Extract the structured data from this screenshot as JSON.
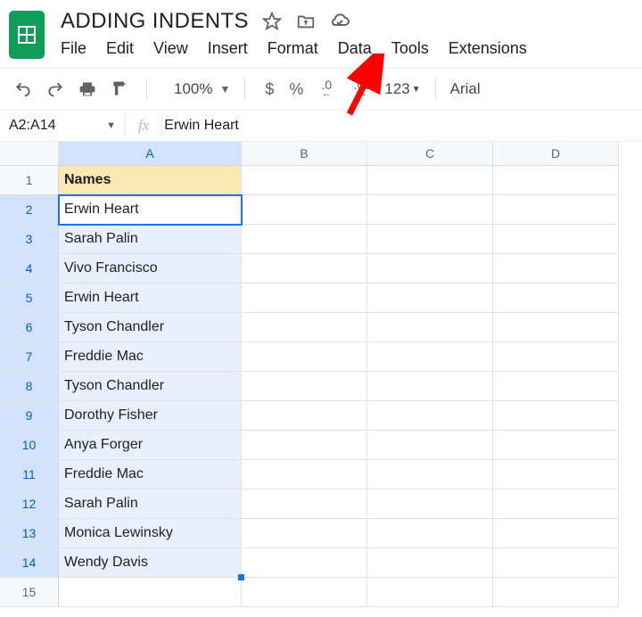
{
  "doc": {
    "title": "ADDING INDENTS"
  },
  "menubar": [
    "File",
    "Edit",
    "View",
    "Insert",
    "Format",
    "Data",
    "Tools",
    "Extensions"
  ],
  "toolbar": {
    "zoom": "100%",
    "currency": "$",
    "percent": "%",
    "dec_dec": ".0",
    "dec_inc": ".00",
    "moreformats": "123",
    "font": "Arial"
  },
  "namebox": "A2:A14",
  "fx_label": "fx",
  "formula": "Erwin Heart",
  "columns": [
    "A",
    "B",
    "C",
    "D"
  ],
  "rows": [
    {
      "n": 1,
      "A": "Names",
      "header": true
    },
    {
      "n": 2,
      "A": "Erwin Heart"
    },
    {
      "n": 3,
      "A": "Sarah Palin"
    },
    {
      "n": 4,
      "A": "Vivo Francisco"
    },
    {
      "n": 5,
      "A": "Erwin Heart"
    },
    {
      "n": 6,
      "A": "Tyson Chandler"
    },
    {
      "n": 7,
      "A": "Freddie Mac"
    },
    {
      "n": 8,
      "A": "Tyson Chandler"
    },
    {
      "n": 9,
      "A": "Dorothy Fisher"
    },
    {
      "n": 10,
      "A": "Anya Forger"
    },
    {
      "n": 11,
      "A": "Freddie Mac"
    },
    {
      "n": 12,
      "A": "Sarah Palin"
    },
    {
      "n": 13,
      "A": "Monica Lewinsky"
    },
    {
      "n": 14,
      "A": "Wendy Davis"
    },
    {
      "n": 15,
      "A": ""
    }
  ],
  "selection": {
    "col": "A",
    "fromRow": 2,
    "toRow": 14,
    "activeRow": 2
  }
}
